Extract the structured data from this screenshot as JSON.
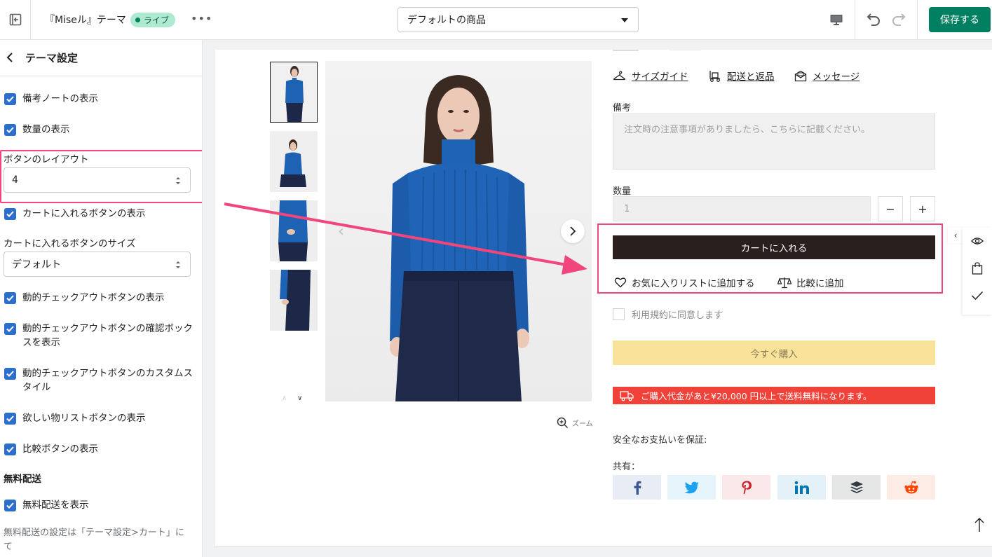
{
  "topbar": {
    "title": "『Miseル』テーマ",
    "badge": "ライブ",
    "more": "•••",
    "template_select": "デフォルトの商品",
    "save_label": "保存する"
  },
  "sidebar": {
    "title": "テーマ設定",
    "checkboxes": {
      "note": "備考ノートの表示",
      "quantity": "数量の表示",
      "cart_button": "カートに入れるボタンの表示",
      "dynamic_checkout": "動的チェックアウトボタンの表示",
      "dynamic_checkout_confirm": "動的チェックアウトボタンの確認ボックスを表示",
      "dynamic_checkout_custom": "動的チェックアウトボタンのカスタムスタイル",
      "wishlist": "欲しい物リストボタンの表示",
      "compare": "比較ボタンの表示",
      "free_shipping": "無料配送を表示"
    },
    "button_layout_label": "ボタンのレイアウト",
    "button_layout_value": "4",
    "cart_button_size_label": "カートに入れるボタンのサイズ",
    "cart_button_size_value": "デフォルト",
    "free_shipping_section": "無料配送",
    "free_shipping_note": "無料配送の設定は「テーマ設定>カート」にて"
  },
  "product": {
    "zoom": "ズーム",
    "links": {
      "size_guide": "サイズガイド",
      "shipping": "配送と返品",
      "message": "メッセージ"
    },
    "note_label": "備考",
    "note_placeholder": "注文時の注意事項がありましたら、こちらに記載ください。",
    "qty_label": "数量",
    "qty_value": "1",
    "qty_minus": "−",
    "qty_plus": "+",
    "add_to_cart": "カートに入れる",
    "wishlist": "お気に入りリストに追加する",
    "compare": "比較に追加",
    "agree": "利用規約に同意します",
    "buy_now": "今すぐ購入",
    "shipping_banner": "ご購入代金があと¥20,000 円以上で送料無料になります。",
    "secure_payment": "安全なお支払いを保証:",
    "share_label": "共有："
  },
  "colors": {
    "accent_green": "#008060",
    "checkbox_blue": "#2c6ecb",
    "highlight_pink": "#f1467c",
    "cart_button": "#2a1f1f",
    "buy_button": "#f9e39b",
    "banner_red": "#f1423a"
  },
  "icons": [
    "exit-icon",
    "desktop-icon",
    "undo-icon",
    "redo-icon",
    "back-chevron-icon",
    "hanger-icon",
    "truck-icon",
    "mail-icon",
    "heart-icon",
    "scale-icon",
    "zoom-icon",
    "eye-icon",
    "bag-icon",
    "check-icon",
    "arrow-up-icon",
    "facebook-icon",
    "twitter-icon",
    "pinterest-icon",
    "linkedin-icon",
    "buffer-icon",
    "reddit-icon"
  ]
}
